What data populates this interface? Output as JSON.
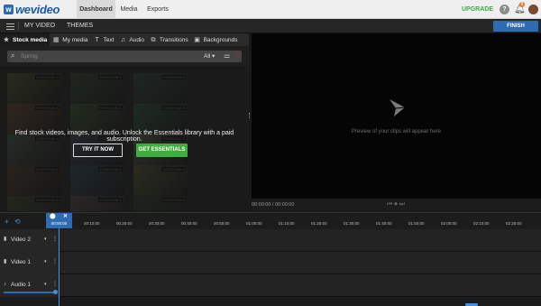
{
  "topbar": {
    "logo_mark": "w",
    "logo_text": "wevideo",
    "tabs": [
      {
        "label": "Dashboard",
        "active": true
      },
      {
        "label": "Media",
        "active": false
      },
      {
        "label": "Exports",
        "active": false
      }
    ],
    "upgrade_label": "UPGRADE",
    "help_glyph": "?",
    "notification_count": "8",
    "icons": [
      "help-icon",
      "bell-icon",
      "avatar"
    ]
  },
  "secondary_bar": {
    "project": "MY VIDEO",
    "themes": "THEMES",
    "finish": "FINISH"
  },
  "media": {
    "tabs": [
      {
        "label": "Stock media",
        "icon": "star-icon",
        "glyph": "★",
        "active": true
      },
      {
        "label": "My media",
        "icon": "media-icon",
        "glyph": "▦",
        "active": false
      },
      {
        "label": "Text",
        "icon": "text-icon",
        "glyph": "T",
        "active": false
      },
      {
        "label": "Audio",
        "icon": "audio-icon",
        "glyph": "♫",
        "active": false
      },
      {
        "label": "Transitions",
        "icon": "transitions-icon",
        "glyph": "⧉",
        "active": false
      },
      {
        "label": "Backgrounds",
        "icon": "backgrounds-icon",
        "glyph": "▣",
        "active": false
      }
    ],
    "search": {
      "placeholder": "Spring",
      "filter_value": "All ▾"
    },
    "promo_text": "Find stock videos, images, and audio. Unlock the Essentials library with a paid subscription.",
    "try_label": "TRY IT NOW",
    "essentials_label": "GET ESSENTIALS",
    "thumbnail_tag": "ESSENTIALS",
    "thumbnail_colors": [
      "#5d6a3a",
      "#3e5a3a",
      "#3b5a4a",
      "#7a5a3a",
      "#4a6a3a",
      "#3b6a4a",
      "#5a6a5a",
      "#4a5a6a",
      "#6a7a5a",
      "#5a4a3a",
      "#3a5a6a",
      "#6a6a4a",
      "#4a5a3a",
      "#6a5a5a",
      "#3a4a3a"
    ]
  },
  "preview": {
    "message": "Preview of your clips will appear here",
    "timecode": "00:00:00 / 00:00:00",
    "transport": "⏮⏺⏭"
  },
  "timeline": {
    "playhead_time": "00:00:00",
    "playhead_pin": "⬤",
    "playhead_close": "✕",
    "add_glyph": "+",
    "magnet_glyph": "⟲",
    "ticks": [
      "00:10:00",
      "00:20:00",
      "00:30:00",
      "00:40:00",
      "00:50:00",
      "01:00:00",
      "01:10:00",
      "01:20:00",
      "01:30:00",
      "01:40:00",
      "01:50:00",
      "02:00:00",
      "02:10:00",
      "02:20:00"
    ],
    "tracks": [
      {
        "name": "Video 2",
        "icon": "video-track-icon",
        "glyph": "▮"
      },
      {
        "name": "Video 1",
        "icon": "video-track-icon",
        "glyph": "▮"
      },
      {
        "name": "Audio 1",
        "icon": "audio-track-icon",
        "glyph": "♪"
      }
    ],
    "track_caret": "▾",
    "track_more": "⋮",
    "audio_volume": 1.0
  }
}
